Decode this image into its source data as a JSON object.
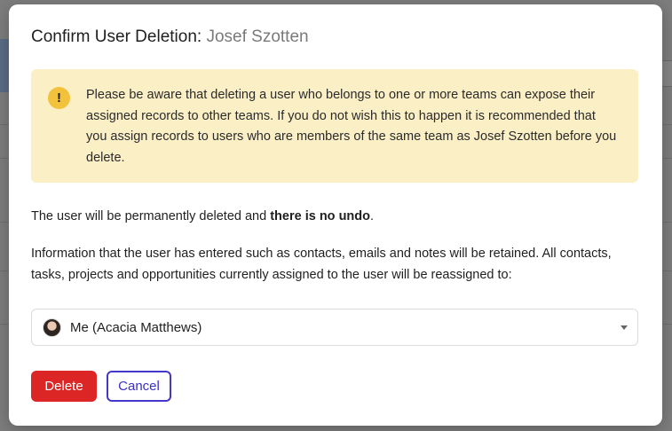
{
  "modal": {
    "title_prefix": "Confirm User Deletion:",
    "title_name": "Josef Szotten"
  },
  "alert": {
    "icon": "!",
    "text": "Please be aware that deleting a user who belongs to one or more teams can expose their assigned records to other teams. If you do not wish this to happen it is recommended that you assign records to users who are members of the same team as Josef Szotten before you delete."
  },
  "body": {
    "line1_prefix": "The user will be permanently deleted and ",
    "line1_bold": "there is no undo",
    "line1_suffix": ".",
    "line2": "Information that the user has entered such as contacts, emails and notes will be retained. All contacts, tasks, projects and opportunities currently assigned to the user will be reassigned to:"
  },
  "reassign_select": {
    "value": "Me (Acacia Matthews)"
  },
  "buttons": {
    "delete": "Delete",
    "cancel": "Cancel"
  },
  "colors": {
    "alert_bg": "#fbefc6",
    "alert_icon": "#f3c23c",
    "delete_btn": "#dc2626",
    "cancel_border": "#4338ca"
  }
}
